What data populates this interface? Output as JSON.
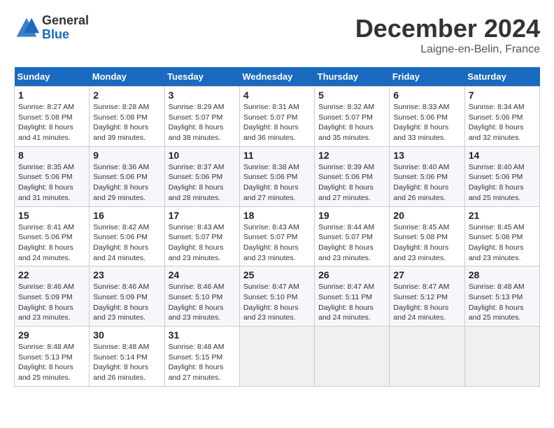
{
  "header": {
    "logo_general": "General",
    "logo_blue": "Blue",
    "month_title": "December 2024",
    "location": "Laigne-en-Belin, France"
  },
  "days_of_week": [
    "Sunday",
    "Monday",
    "Tuesday",
    "Wednesday",
    "Thursday",
    "Friday",
    "Saturday"
  ],
  "weeks": [
    [
      {
        "day": "1",
        "info": "Sunrise: 8:27 AM\nSunset: 5:08 PM\nDaylight: 8 hours and 41 minutes."
      },
      {
        "day": "2",
        "info": "Sunrise: 8:28 AM\nSunset: 5:08 PM\nDaylight: 8 hours and 39 minutes."
      },
      {
        "day": "3",
        "info": "Sunrise: 8:29 AM\nSunset: 5:07 PM\nDaylight: 8 hours and 38 minutes."
      },
      {
        "day": "4",
        "info": "Sunrise: 8:31 AM\nSunset: 5:07 PM\nDaylight: 8 hours and 36 minutes."
      },
      {
        "day": "5",
        "info": "Sunrise: 8:32 AM\nSunset: 5:07 PM\nDaylight: 8 hours and 35 minutes."
      },
      {
        "day": "6",
        "info": "Sunrise: 8:33 AM\nSunset: 5:06 PM\nDaylight: 8 hours and 33 minutes."
      },
      {
        "day": "7",
        "info": "Sunrise: 8:34 AM\nSunset: 5:06 PM\nDaylight: 8 hours and 32 minutes."
      }
    ],
    [
      {
        "day": "8",
        "info": "Sunrise: 8:35 AM\nSunset: 5:06 PM\nDaylight: 8 hours and 31 minutes."
      },
      {
        "day": "9",
        "info": "Sunrise: 8:36 AM\nSunset: 5:06 PM\nDaylight: 8 hours and 29 minutes."
      },
      {
        "day": "10",
        "info": "Sunrise: 8:37 AM\nSunset: 5:06 PM\nDaylight: 8 hours and 28 minutes."
      },
      {
        "day": "11",
        "info": "Sunrise: 8:38 AM\nSunset: 5:06 PM\nDaylight: 8 hours and 27 minutes."
      },
      {
        "day": "12",
        "info": "Sunrise: 8:39 AM\nSunset: 5:06 PM\nDaylight: 8 hours and 27 minutes."
      },
      {
        "day": "13",
        "info": "Sunrise: 8:40 AM\nSunset: 5:06 PM\nDaylight: 8 hours and 26 minutes."
      },
      {
        "day": "14",
        "info": "Sunrise: 8:40 AM\nSunset: 5:06 PM\nDaylight: 8 hours and 25 minutes."
      }
    ],
    [
      {
        "day": "15",
        "info": "Sunrise: 8:41 AM\nSunset: 5:06 PM\nDaylight: 8 hours and 24 minutes."
      },
      {
        "day": "16",
        "info": "Sunrise: 8:42 AM\nSunset: 5:06 PM\nDaylight: 8 hours and 24 minutes."
      },
      {
        "day": "17",
        "info": "Sunrise: 8:43 AM\nSunset: 5:07 PM\nDaylight: 8 hours and 23 minutes."
      },
      {
        "day": "18",
        "info": "Sunrise: 8:43 AM\nSunset: 5:07 PM\nDaylight: 8 hours and 23 minutes."
      },
      {
        "day": "19",
        "info": "Sunrise: 8:44 AM\nSunset: 5:07 PM\nDaylight: 8 hours and 23 minutes."
      },
      {
        "day": "20",
        "info": "Sunrise: 8:45 AM\nSunset: 5:08 PM\nDaylight: 8 hours and 23 minutes."
      },
      {
        "day": "21",
        "info": "Sunrise: 8:45 AM\nSunset: 5:08 PM\nDaylight: 8 hours and 23 minutes."
      }
    ],
    [
      {
        "day": "22",
        "info": "Sunrise: 8:46 AM\nSunset: 5:09 PM\nDaylight: 8 hours and 23 minutes."
      },
      {
        "day": "23",
        "info": "Sunrise: 8:46 AM\nSunset: 5:09 PM\nDaylight: 8 hours and 23 minutes."
      },
      {
        "day": "24",
        "info": "Sunrise: 8:46 AM\nSunset: 5:10 PM\nDaylight: 8 hours and 23 minutes."
      },
      {
        "day": "25",
        "info": "Sunrise: 8:47 AM\nSunset: 5:10 PM\nDaylight: 8 hours and 23 minutes."
      },
      {
        "day": "26",
        "info": "Sunrise: 8:47 AM\nSunset: 5:11 PM\nDaylight: 8 hours and 24 minutes."
      },
      {
        "day": "27",
        "info": "Sunrise: 8:47 AM\nSunset: 5:12 PM\nDaylight: 8 hours and 24 minutes."
      },
      {
        "day": "28",
        "info": "Sunrise: 8:48 AM\nSunset: 5:13 PM\nDaylight: 8 hours and 25 minutes."
      }
    ],
    [
      {
        "day": "29",
        "info": "Sunrise: 8:48 AM\nSunset: 5:13 PM\nDaylight: 8 hours and 25 minutes."
      },
      {
        "day": "30",
        "info": "Sunrise: 8:48 AM\nSunset: 5:14 PM\nDaylight: 8 hours and 26 minutes."
      },
      {
        "day": "31",
        "info": "Sunrise: 8:48 AM\nSunset: 5:15 PM\nDaylight: 8 hours and 27 minutes."
      },
      null,
      null,
      null,
      null
    ]
  ]
}
